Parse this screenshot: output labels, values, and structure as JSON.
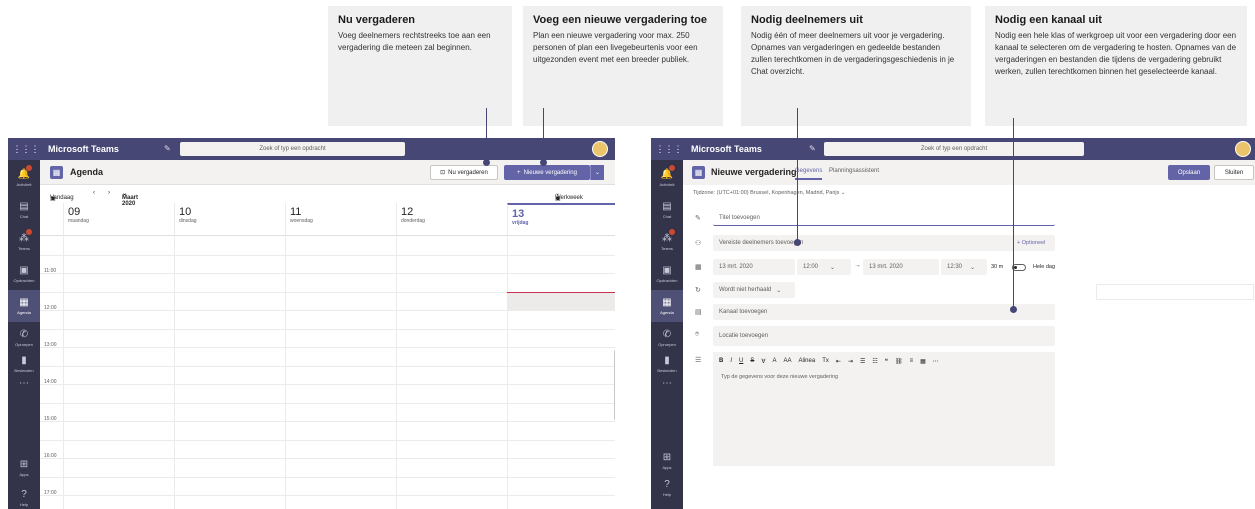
{
  "callouts": [
    {
      "title": "Nu vergaderen",
      "body": "Voeg deelnemers rechtstreeks toe aan een vergadering die meteen zal beginnen."
    },
    {
      "title": "Voeg een nieuwe vergadering toe",
      "body": "Plan een nieuwe vergadering voor max. 250 personen of plan een livegebeurtenis voor een uitgezonden event met een breeder publiek."
    },
    {
      "title": "Nodig deelnemers uit",
      "body": "Nodig één of meer deelnemers uit voor je vergadering. Opnames van vergaderingen en gedeelde bestanden zullen terechtkomen in de vergaderingsgeschiedenis  in je Chat overzicht."
    },
    {
      "title": "Nodig een kanaal uit",
      "body": "Nodig een hele klas of werkgroep uit voor een vergadering door een kanaal te selecteren om de vergadering te hosten. Opnames van de vergaderingen en bestanden die tijdens de vergadering gebruikt werken, zullen terechtkomen binnen het geselecteerde kanaal."
    }
  ],
  "app": {
    "name": "Microsoft Teams",
    "search_placeholder": "Zoek of typ een opdracht",
    "grid_icon": "⋮⋮⋮"
  },
  "rail": [
    {
      "label": "Activiteit",
      "icon": "bell-icon",
      "glyph": "🔔"
    },
    {
      "label": "Chat",
      "icon": "chat-icon",
      "glyph": "▤"
    },
    {
      "label": "Teams",
      "icon": "teams-icon",
      "glyph": "⁂"
    },
    {
      "label": "Opdrachten",
      "icon": "assignments-icon",
      "glyph": "▣"
    },
    {
      "label": "Agenda",
      "icon": "calendar-icon",
      "glyph": "▦"
    },
    {
      "label": "Oproepen",
      "icon": "phone-icon",
      "glyph": "✆"
    },
    {
      "label": "Bestanden",
      "icon": "files-icon",
      "glyph": "▮"
    },
    {
      "label": "Apps",
      "icon": "apps-icon",
      "glyph": "⊞"
    },
    {
      "label": "Help",
      "icon": "help-icon",
      "glyph": "?"
    }
  ],
  "agenda": {
    "title": "Agenda",
    "now_button": "Nu vergaderen",
    "new_button": "Nieuwe vergadering",
    "today": "Vandaag",
    "month": "Maart 2020",
    "view": "Werkweek",
    "days": [
      {
        "num": "09",
        "name": "maandag"
      },
      {
        "num": "10",
        "name": "dinsdag"
      },
      {
        "num": "11",
        "name": "woensdag"
      },
      {
        "num": "12",
        "name": "donderdag"
      },
      {
        "num": "13",
        "name": "vrijdag"
      }
    ],
    "hours": [
      "11:00",
      "12:00",
      "13:00",
      "14:00",
      "15:00",
      "16:00",
      "17:00"
    ]
  },
  "meeting": {
    "title": "Nieuwe vergadering",
    "tab_details": "Gegevens",
    "tab_assistant": "Planningsassistent",
    "save": "Opslaan",
    "close": "Sluiten",
    "timezone": "Tijdzone: (UTC+01:00) Brussel, Kopenhagen, Madrid, Parijs",
    "title_placeholder": "Titel toevoegen",
    "attendees_placeholder": "Vereiste deelnemers toevoegen",
    "optional": "+ Optioneel",
    "start_date": "13 mrt. 2020",
    "start_time": "12:00",
    "end_date": "13 mrt. 2020",
    "end_time": "12:30",
    "duration": "30 m",
    "all_day": "Hele dag",
    "repeat": "Wordt niet herhaald",
    "channel_placeholder": "Kanaal toevoegen",
    "location_placeholder": "Locatie toevoegen",
    "editor_placeholder": "Typ de gegevens voor deze nieuwe vergadering",
    "toolbar": [
      "B",
      "I",
      "U",
      "S",
      "∀",
      "A",
      "AA",
      "Alinea",
      "Tx",
      "⇤",
      "⇥",
      "☰",
      "☷",
      "❝",
      "⛓",
      "≡",
      "▦",
      "⋯"
    ]
  },
  "colors": {
    "brand": "#464775",
    "accent": "#6264a7",
    "rail": "#33344a",
    "now_line": "#c4314b"
  }
}
